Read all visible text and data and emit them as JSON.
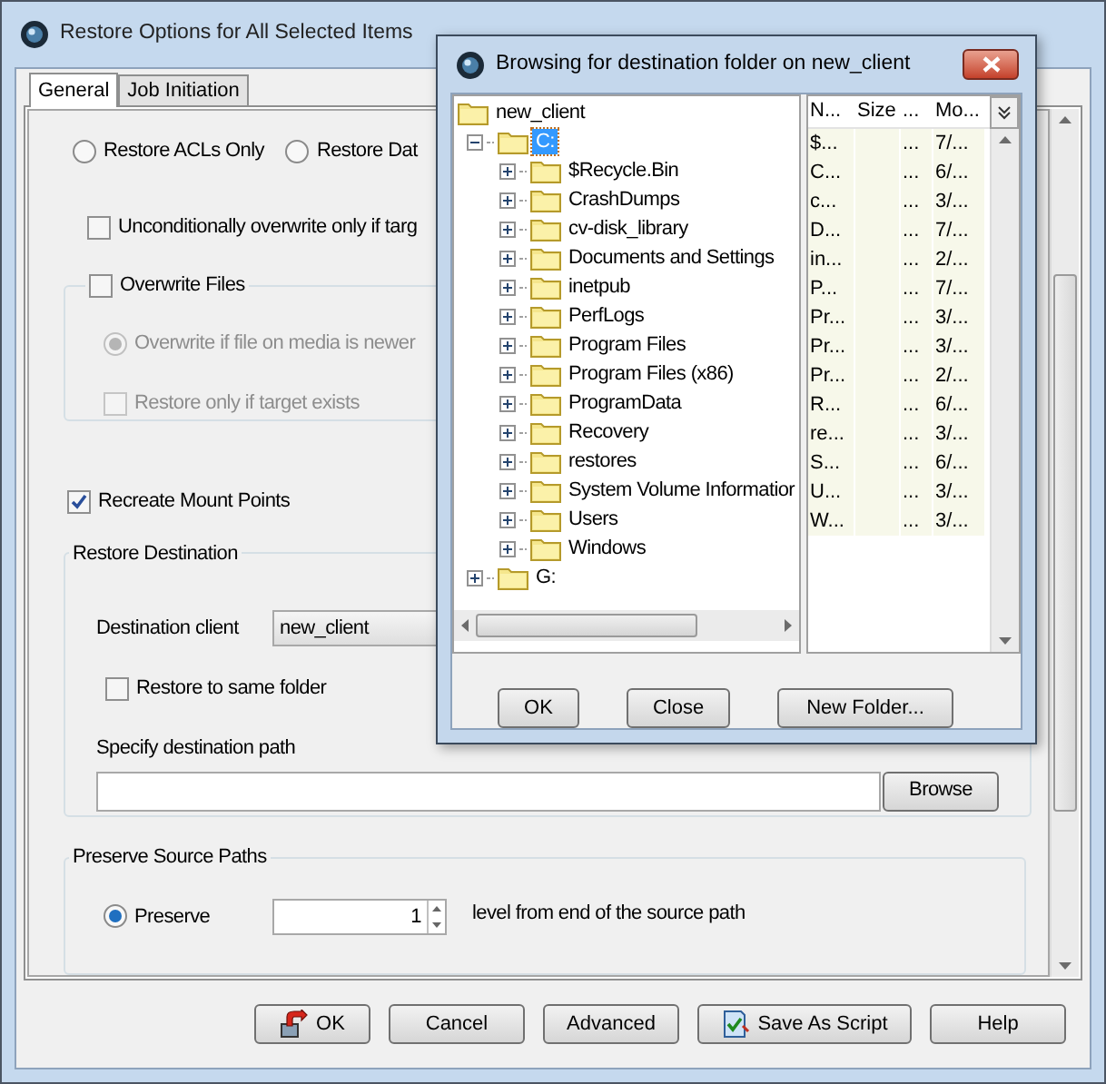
{
  "window": {
    "title": "Restore Options for All Selected Items"
  },
  "tabs": [
    {
      "label": "General",
      "selected": true
    },
    {
      "label": "Job Initiation",
      "selected": false
    }
  ],
  "restore_type": [
    {
      "label": "Restore ACLs Only",
      "selected": false
    },
    {
      "label": "Restore Dat",
      "selected": false
    }
  ],
  "unconditional_overwrite": {
    "label": "Unconditionally overwrite only if targ",
    "checked": false
  },
  "overwrite_files": {
    "label": "Overwrite Files",
    "checked": false,
    "radio": {
      "label": "Overwrite if file on media is newer",
      "selected": true,
      "disabled": true
    },
    "target_exists": {
      "label": "Restore only if target exists",
      "checked": false,
      "disabled": true
    }
  },
  "recreate_mount_points": {
    "label": "Recreate Mount Points",
    "checked": true
  },
  "restore_destination": {
    "title": "Restore Destination",
    "client_label": "Destination client",
    "client_value": "new_client",
    "same_folder": {
      "label": "Restore to same folder",
      "checked": false
    },
    "path_label": "Specify destination path",
    "browse": "Browse"
  },
  "preserve_source_paths": {
    "title": "Preserve Source Paths",
    "radio": {
      "label": "Preserve",
      "selected": true
    },
    "value": "1",
    "suffix": "level from end of the source path"
  },
  "buttons": [
    {
      "label": "OK",
      "kind": "primary"
    },
    {
      "label": "Cancel",
      "kind": "plain"
    },
    {
      "label": "Advanced",
      "kind": "plain"
    },
    {
      "label": "Save As Script",
      "kind": "script"
    },
    {
      "label": "Help",
      "kind": "plain"
    }
  ],
  "dialog": {
    "title": "Browsing for destination folder on new_client",
    "tree": [
      {
        "label": "new_client",
        "selected": false,
        "children": [
          {
            "label": "C:",
            "selected": true,
            "expanded": true,
            "children": [
              {
                "label": "$Recycle.Bin",
                "selected": false,
                "expanded": false
              },
              {
                "label": "CrashDumps",
                "selected": false,
                "expanded": false
              },
              {
                "label": "cv-disk_library",
                "selected": false,
                "expanded": false
              },
              {
                "label": "Documents and Settings",
                "selected": false,
                "expanded": false
              },
              {
                "label": "inetpub",
                "selected": false,
                "expanded": false
              },
              {
                "label": "PerfLogs",
                "selected": false,
                "expanded": false
              },
              {
                "label": "Program Files",
                "selected": false,
                "expanded": false
              },
              {
                "label": "Program Files (x86)",
                "selected": false,
                "expanded": false
              },
              {
                "label": "ProgramData",
                "selected": false,
                "expanded": false
              },
              {
                "label": "Recovery",
                "selected": false,
                "expanded": false
              },
              {
                "label": "restores",
                "selected": false,
                "expanded": false
              },
              {
                "label": "System Volume Informatior",
                "selected": false,
                "expanded": false
              },
              {
                "label": "Users",
                "selected": false,
                "expanded": false
              },
              {
                "label": "Windows",
                "selected": false,
                "expanded": false
              }
            ]
          },
          {
            "label": "G:",
            "selected": false,
            "expanded": false
          }
        ]
      }
    ],
    "list_columns": [
      "N...",
      "Size",
      "...",
      "Mo..."
    ],
    "list_rows": [
      [
        "$...",
        "",
        "...",
        "7/..."
      ],
      [
        "C...",
        "",
        "...",
        "6/..."
      ],
      [
        "c...",
        "",
        "...",
        "3/..."
      ],
      [
        "D...",
        "",
        "...",
        "7/..."
      ],
      [
        "in...",
        "",
        "...",
        "2/..."
      ],
      [
        "P...",
        "",
        "...",
        "7/..."
      ],
      [
        "Pr...",
        "",
        "...",
        "3/..."
      ],
      [
        "Pr...",
        "",
        "...",
        "3/..."
      ],
      [
        "Pr...",
        "",
        "...",
        "2/..."
      ],
      [
        "R...",
        "",
        "...",
        "6/..."
      ],
      [
        "re...",
        "",
        "...",
        "3/..."
      ],
      [
        "S...",
        "",
        "...",
        "6/..."
      ],
      [
        "U...",
        "",
        "...",
        "3/..."
      ],
      [
        "W...",
        "",
        "...",
        "3/..."
      ]
    ],
    "buttons": [
      "OK",
      "Close",
      "New Folder..."
    ]
  }
}
